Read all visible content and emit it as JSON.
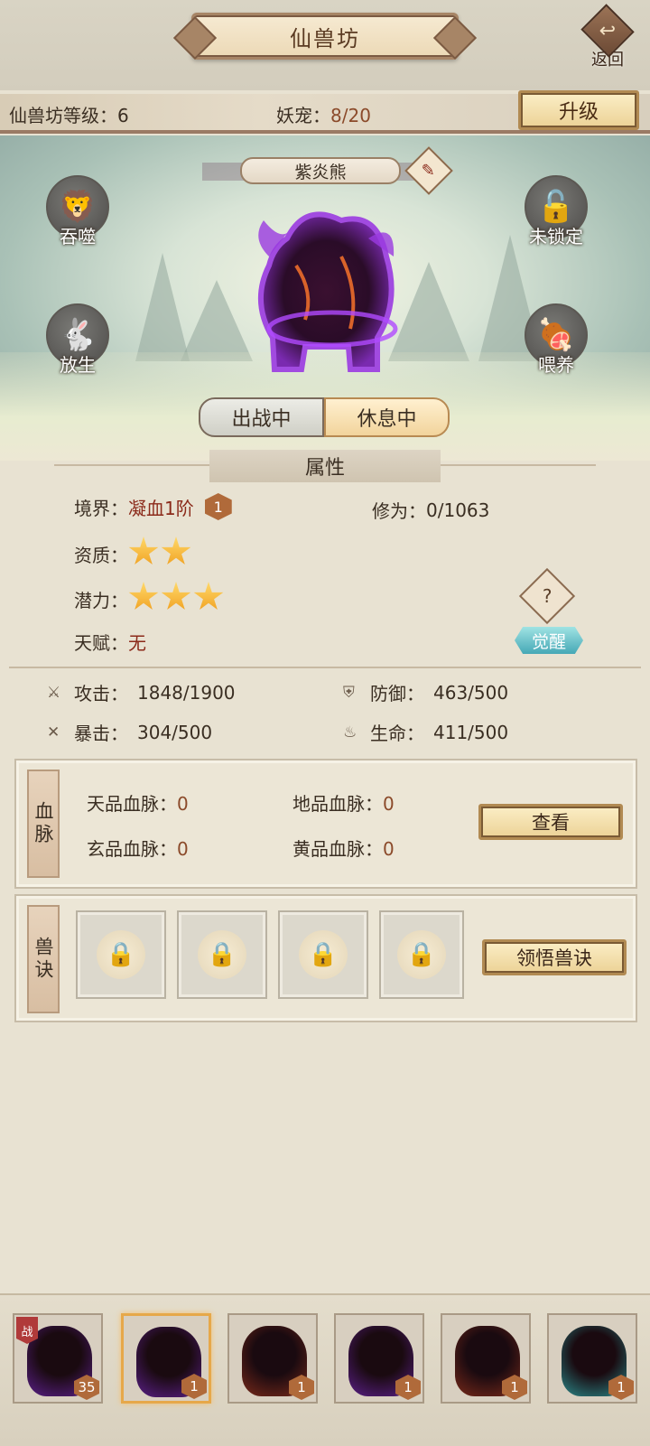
{
  "header": {
    "title": "仙兽坊",
    "back_label": "返回",
    "back_icon": "return-arrow-icon"
  },
  "level_bar": {
    "level_label": "仙兽坊等级：6",
    "pet_label": "妖宠：",
    "pet_count": "8/20",
    "upgrade_label": "升级"
  },
  "beast": {
    "name": "紫炎熊",
    "edit_icon": "brush-icon",
    "color": "#5b1f8a"
  },
  "side_actions": {
    "devour": "吞噬",
    "lock": "未锁定",
    "release": "放生",
    "feed": "喂养"
  },
  "status": {
    "battle": "出战中",
    "rest": "休息中"
  },
  "attributes": {
    "section_title": "属性",
    "realm_label": "境界：",
    "realm_value": "凝血1阶",
    "realm_badge": "1",
    "cultivation_label": "修为：",
    "cultivation_value": "0/1063",
    "aptitude_label": "资质：",
    "aptitude_stars": 2,
    "potential_label": "潜力：",
    "potential_stars": 3,
    "talent_label": "天赋：",
    "talent_value": "无",
    "help_label": "?",
    "awaken_label": "觉醒"
  },
  "stats": {
    "attack_label": "攻击：",
    "attack_value": "1848/1900",
    "defense_label": "防御：",
    "defense_value": "463/500",
    "crit_label": "暴击：",
    "crit_value": "304/500",
    "hp_label": "生命：",
    "hp_value": "411/500"
  },
  "bloodline": {
    "tag": "血脉",
    "heaven_label": "天品血脉：",
    "heaven_value": "0",
    "earth_label": "地品血脉：",
    "earth_value": "0",
    "mystic_label": "玄品血脉：",
    "mystic_value": "0",
    "yellow_label": "黄品血脉：",
    "yellow_value": "0",
    "view_label": "查看"
  },
  "skills": {
    "tag": "兽诀",
    "learn_label": "领悟兽诀",
    "slot_icon": "lock-icon"
  },
  "pets": [
    {
      "level": "35",
      "battle": "战",
      "color": "#5b1f8a"
    },
    {
      "level": "1",
      "color": "#5b1f8a"
    },
    {
      "level": "1",
      "color": "#7a2a1a"
    },
    {
      "level": "1",
      "color": "#5b1f8a"
    },
    {
      "level": "1",
      "color": "#7a2a1a"
    },
    {
      "level": "1",
      "color": "#2a8a8a"
    }
  ]
}
